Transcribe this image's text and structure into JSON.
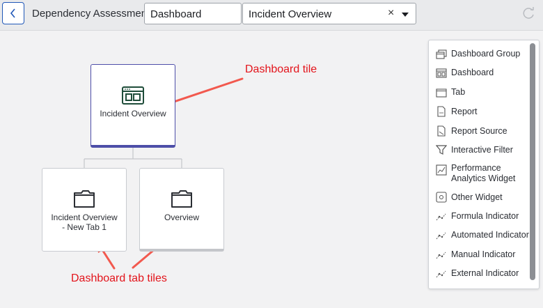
{
  "header": {
    "app_title": "Dependency Assessment",
    "dashboard_field": "Dashboard",
    "incident_field": "Incident Overview",
    "clear_glyph": "×"
  },
  "canvas": {
    "main_tile_label": "Incident Overview",
    "tab_tile_1_label_line1": "Incident Overview",
    "tab_tile_1_label_line2": "- New Tab 1",
    "tab_tile_2_label": "Overview"
  },
  "annotations": {
    "dashboard_tile": "Dashboard tile",
    "dashboard_tab_tiles": "Dashboard tab tiles"
  },
  "palette": {
    "items": [
      {
        "label": "Dashboard Group",
        "icon": "dashboard-group-icon"
      },
      {
        "label": "Dashboard",
        "icon": "dashboard-icon"
      },
      {
        "label": "Tab",
        "icon": "tab-icon"
      },
      {
        "label": "Report",
        "icon": "report-icon"
      },
      {
        "label": "Report Source",
        "icon": "report-source-icon"
      },
      {
        "label": "Interactive Filter",
        "icon": "filter-icon"
      },
      {
        "label_line1": "Performance",
        "label_line2": "Analytics Widget",
        "icon": "performance-analytics-icon"
      },
      {
        "label": "Other Widget",
        "icon": "other-widget-icon"
      },
      {
        "label": "Formula Indicator",
        "icon": "formula-indicator-icon"
      },
      {
        "label": "Automated Indicator",
        "icon": "automated-indicator-icon"
      },
      {
        "label": "Manual Indicator",
        "icon": "manual-indicator-icon"
      },
      {
        "label": "External Indicator",
        "icon": "external-indicator-icon"
      }
    ]
  },
  "colors": {
    "accent": "#4d4ea8",
    "annotation": "#e3141b",
    "icon_dark": "#1f4d3a"
  }
}
